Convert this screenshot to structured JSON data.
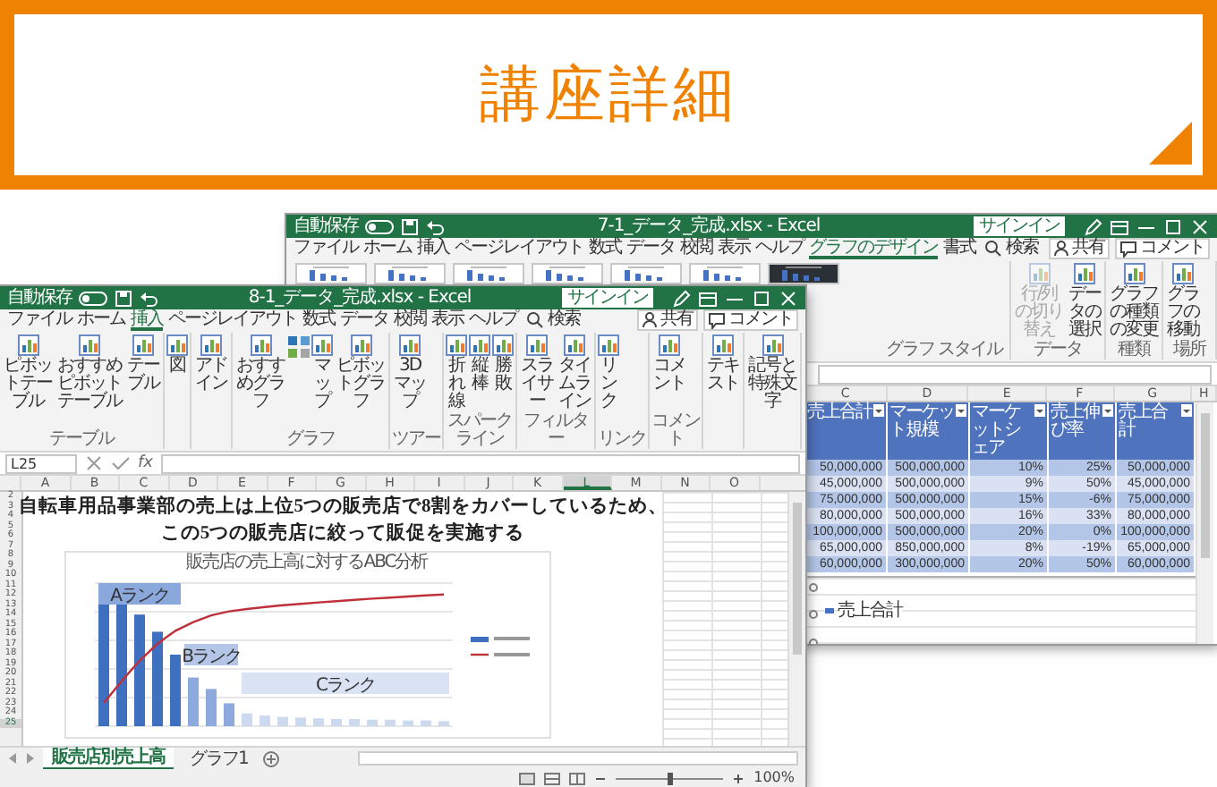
{
  "banner": {
    "title": "講座詳細"
  },
  "back_window": {
    "title_bar": {
      "autosave": "自動保存",
      "file_name": "7-1_データ_完成.xlsx - Excel",
      "signin": "サインイン"
    },
    "tabs": [
      {
        "label": "ファイル",
        "selected": false
      },
      {
        "label": "ホーム",
        "selected": false
      },
      {
        "label": "挿入",
        "selected": false
      },
      {
        "label": "ページレイアウト",
        "selected": false
      },
      {
        "label": "数式",
        "selected": false
      },
      {
        "label": "データ",
        "selected": false
      },
      {
        "label": "校閲",
        "selected": false
      },
      {
        "label": "表示",
        "selected": false
      },
      {
        "label": "ヘルプ",
        "selected": false
      },
      {
        "label": "グラフのデザイン",
        "selected": true
      },
      {
        "label": "書式",
        "selected": false
      }
    ],
    "search": "検索",
    "share": "共有",
    "comment": "コメント",
    "ribbon": [
      {
        "kind": "gallery",
        "label": "グラフ スタイル"
      },
      {
        "kind": "buttons",
        "label": "データ",
        "items": [
          {
            "kind": "button",
            "label": "行/列の切り替え",
            "disabled": true
          },
          {
            "kind": "button",
            "label": "データの選択",
            "disabled": false
          }
        ]
      },
      {
        "kind": "buttons",
        "label": "種類",
        "items": [
          {
            "kind": "button",
            "label": "グラフの種類の変更",
            "disabled": false
          }
        ]
      },
      {
        "kind": "buttons",
        "label": "場所",
        "items": [
          {
            "kind": "button",
            "label": "グラフの移動",
            "disabled": false
          }
        ]
      }
    ],
    "columns": [
      {
        "label": "C"
      },
      {
        "label": "D"
      },
      {
        "label": "E"
      },
      {
        "label": "F"
      },
      {
        "label": "G"
      },
      {
        "label": "H"
      }
    ],
    "table": {
      "columns": [
        "売上合計",
        "マーケット規模",
        "マーケットシェア",
        "売上伸び率",
        "売上合計"
      ],
      "rows": [
        [
          "50,000,000",
          "500,000,000",
          "10%",
          "25%",
          "50,000,000"
        ],
        [
          "45,000,000",
          "500,000,000",
          "9%",
          "50%",
          "45,000,000"
        ],
        [
          "75,000,000",
          "500,000,000",
          "15%",
          "-6%",
          "75,000,000"
        ],
        [
          "80,000,000",
          "500,000,000",
          "16%",
          "33%",
          "80,000,000"
        ],
        [
          "100,000,000",
          "500,000,000",
          "20%",
          "0%",
          "100,000,000"
        ],
        [
          "65,000,000",
          "850,000,000",
          "8%",
          "-19%",
          "65,000,000"
        ],
        [
          "60,000,000",
          "300,000,000",
          "20%",
          "50%",
          "60,000,000"
        ]
      ]
    },
    "chart": {
      "legend": "売上合計"
    }
  },
  "front_window": {
    "title_bar": {
      "autosave": "自動保存",
      "file_name": "8-1_データ_完成.xlsx - Excel",
      "signin": "サインイン"
    },
    "tabs": [
      {
        "label": "ファイル",
        "selected": false
      },
      {
        "label": "ホーム",
        "selected": false
      },
      {
        "label": "挿入",
        "selected": true
      },
      {
        "label": "ページレイアウト",
        "selected": false
      },
      {
        "label": "数式",
        "selected": false
      },
      {
        "label": "データ",
        "selected": false
      },
      {
        "label": "校閲",
        "selected": false
      },
      {
        "label": "表示",
        "selected": false
      },
      {
        "label": "ヘルプ",
        "selected": false
      }
    ],
    "search": "検索",
    "share": "共有",
    "comment": "コメント",
    "ribbon": [
      {
        "kind": "buttons",
        "label": "テーブル",
        "items": [
          {
            "kind": "button",
            "label": "ピボットテーブル"
          },
          {
            "kind": "button",
            "label": "おすすめピボットテーブル"
          },
          {
            "kind": "button",
            "label": "テーブル"
          }
        ]
      },
      {
        "kind": "buttons",
        "items": [
          {
            "kind": "button",
            "label": "図"
          }
        ]
      },
      {
        "kind": "buttons",
        "items": [
          {
            "kind": "button",
            "label": "アドイン"
          }
        ]
      },
      {
        "kind": "buttons",
        "label": "グラフ",
        "items": [
          {
            "kind": "button",
            "label": "おすすめグラフ"
          },
          {
            "kind": "icon-grid"
          },
          {
            "kind": "button",
            "label": "マップ"
          },
          {
            "kind": "button",
            "label": "ピボットグラフ"
          }
        ]
      },
      {
        "kind": "buttons",
        "label": "ツアー",
        "items": [
          {
            "kind": "button",
            "label": "3Dマップ"
          }
        ]
      },
      {
        "kind": "buttons",
        "label": "スパークライン",
        "items": [
          {
            "kind": "button",
            "label": "折れ線"
          },
          {
            "kind": "button",
            "label": "縦棒"
          },
          {
            "kind": "button",
            "label": "勝敗"
          }
        ]
      },
      {
        "kind": "buttons",
        "label": "フィルター",
        "items": [
          {
            "kind": "button",
            "label": "スライサー"
          },
          {
            "kind": "button",
            "label": "タイムライン"
          }
        ]
      },
      {
        "kind": "buttons",
        "label": "リンク",
        "items": [
          {
            "kind": "button",
            "label": "リンク"
          }
        ]
      },
      {
        "kind": "buttons",
        "label": "コメント",
        "items": [
          {
            "kind": "button",
            "label": "コメント"
          }
        ]
      },
      {
        "kind": "buttons",
        "items": [
          {
            "kind": "button",
            "label": "テキスト"
          }
        ]
      },
      {
        "kind": "buttons",
        "items": [
          {
            "kind": "button",
            "label": "記号と特殊文字"
          }
        ]
      }
    ],
    "name_box": "L25",
    "function_label": "fx",
    "columns": [
      {
        "label": "A",
        "selected": false
      },
      {
        "label": "B",
        "selected": false
      },
      {
        "label": "C",
        "selected": false
      },
      {
        "label": "D",
        "selected": false
      },
      {
        "label": "E",
        "selected": false
      },
      {
        "label": "F",
        "selected": false
      },
      {
        "label": "G",
        "selected": false
      },
      {
        "label": "H",
        "selected": false
      },
      {
        "label": "I",
        "selected": false
      },
      {
        "label": "J",
        "selected": false
      },
      {
        "label": "K",
        "selected": false
      },
      {
        "label": "L",
        "selected": true
      },
      {
        "label": "M",
        "selected": false
      },
      {
        "label": "N",
        "selected": false
      },
      {
        "label": "O",
        "selected": false
      }
    ],
    "rows": [
      {
        "label": "2",
        "selected": false
      },
      {
        "label": "3",
        "selected": false
      },
      {
        "label": "4",
        "selected": false
      },
      {
        "label": "5",
        "selected": false
      },
      {
        "label": "6",
        "selected": false
      },
      {
        "label": "7",
        "selected": false
      },
      {
        "label": "8",
        "selected": false
      },
      {
        "label": "9",
        "selected": false
      },
      {
        "label": "10",
        "selected": false
      },
      {
        "label": "11",
        "selected": false
      },
      {
        "label": "12",
        "selected": false
      },
      {
        "label": "13",
        "selected": false
      },
      {
        "label": "14",
        "selected": false
      },
      {
        "label": "15",
        "selected": false
      },
      {
        "label": "16",
        "selected": false
      },
      {
        "label": "17",
        "selected": false
      },
      {
        "label": "18",
        "selected": false
      },
      {
        "label": "19",
        "selected": false
      },
      {
        "label": "20",
        "selected": false
      },
      {
        "label": "21",
        "selected": false
      },
      {
        "label": "22",
        "selected": false
      },
      {
        "label": "23",
        "selected": false
      },
      {
        "label": "24",
        "selected": false
      },
      {
        "label": "25",
        "selected": true
      }
    ],
    "heading": [
      "自転車用品事業部の売上は上位5つの販売店で8割をカバーしているため、",
      "この5つの販売店に絞って販促を実施する"
    ],
    "chart": {
      "title": "販売店の売上高に対するABC分析",
      "ranks": [
        "Aランク",
        "Bランク",
        "Cランク"
      ]
    },
    "sheet_tabs": [
      {
        "label": "販売店別売上高",
        "selected": true
      },
      {
        "label": "グラフ1",
        "selected": false
      }
    ],
    "zoom_slider": {
      "level": 0.5
    },
    "zoom": "100%"
  }
}
